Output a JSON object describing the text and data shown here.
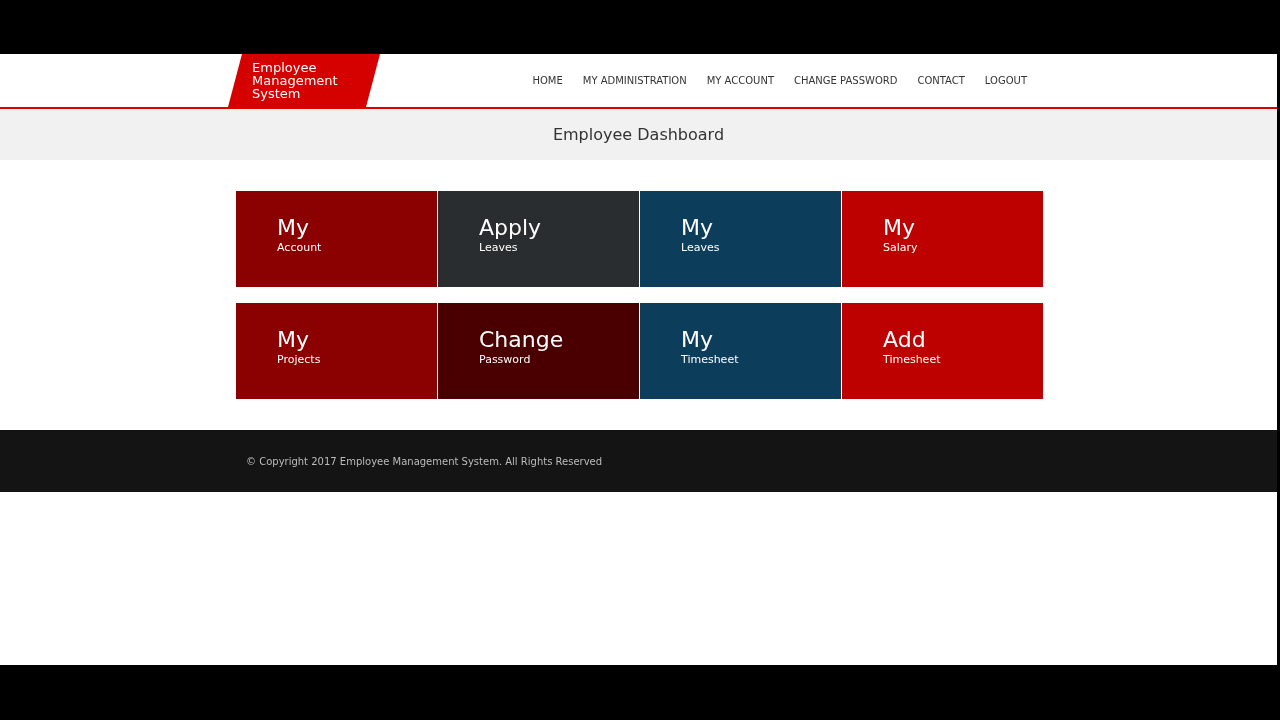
{
  "header": {
    "logo": "Employee Management System",
    "nav": [
      {
        "label": "HOME"
      },
      {
        "label": "MY ADMINISTRATION"
      },
      {
        "label": "MY ACCOUNT"
      },
      {
        "label": "CHANGE PASSWORD"
      },
      {
        "label": "CONTACT"
      },
      {
        "label": "LOGOUT"
      }
    ]
  },
  "page_title": "Employee Dashboard",
  "tiles": [
    {
      "title": "My",
      "subtitle": "Account",
      "color": "#8b0000"
    },
    {
      "title": "Apply",
      "subtitle": "Leaves",
      "color": "#2a2d2f"
    },
    {
      "title": "My",
      "subtitle": "Leaves",
      "color": "#0c3e5c"
    },
    {
      "title": "My",
      "subtitle": "Salary",
      "color": "#bd0000"
    },
    {
      "title": "My",
      "subtitle": "Projects",
      "color": "#8b0000"
    },
    {
      "title": "Change",
      "subtitle": "Password",
      "color": "#4a0000"
    },
    {
      "title": "My",
      "subtitle": "Timesheet",
      "color": "#0c3e5c"
    },
    {
      "title": "Add",
      "subtitle": "Timesheet",
      "color": "#bd0000"
    }
  ],
  "footer": {
    "copyright": "© Copyright 2017 Employee Management System. All Rights Reserved"
  }
}
